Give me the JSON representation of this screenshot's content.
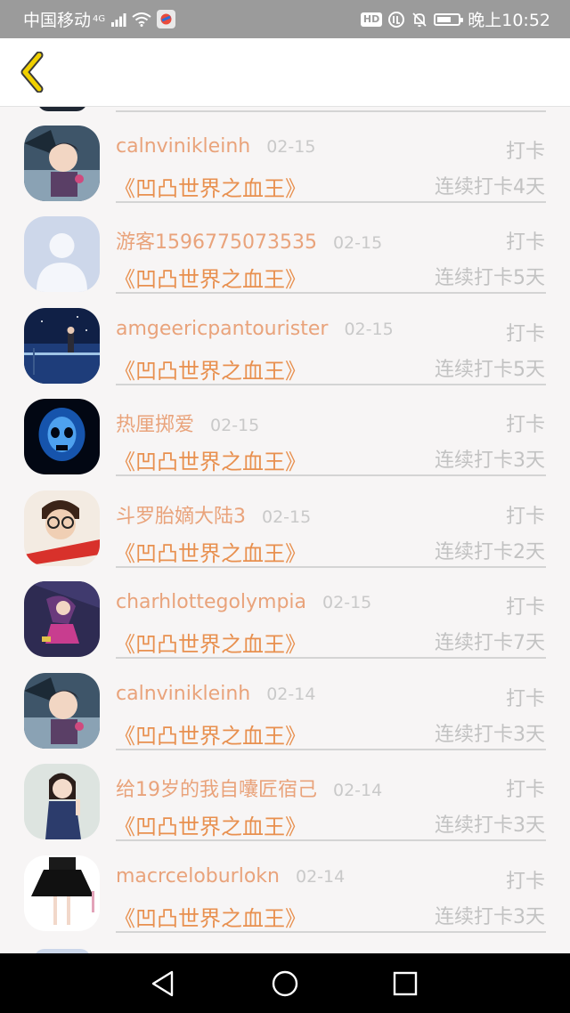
{
  "status_bar": {
    "carrier": "中国移动",
    "network": "4G",
    "time": "晚上10:52",
    "hd_badge": "HD",
    "battery_level": 0.68
  },
  "rows": [
    {
      "username": "calnvinikleinh",
      "date": "02-15",
      "action": "打卡",
      "book": "《凹凸世界之血王》",
      "streak": "连续打卡4天",
      "avatar": "anime-boy-avatar"
    },
    {
      "username": "游客1596775073535",
      "date": "02-15",
      "action": "打卡",
      "book": "《凹凸世界之血王》",
      "streak": "连续打卡5天",
      "avatar": "default-user-avatar"
    },
    {
      "username": "amgeericpantourister",
      "date": "02-15",
      "action": "打卡",
      "book": "《凹凸世界之血王》",
      "streak": "连续打卡5天",
      "avatar": "night-scene-avatar"
    },
    {
      "username": "热厘掷爱",
      "date": "02-15",
      "action": "打卡",
      "book": "《凹凸世界之血王》",
      "streak": "连续打卡3天",
      "avatar": "blue-skull-avatar"
    },
    {
      "username": "斗罗胎嫡大陆3",
      "date": "02-15",
      "action": "打卡",
      "book": "《凹凸世界之血王》",
      "streak": "连续打卡2天",
      "avatar": "glasses-boy-avatar"
    },
    {
      "username": "charhlottegolympia",
      "date": "02-15",
      "action": "打卡",
      "book": "《凹凸世界之血王》",
      "streak": "连续打卡7天",
      "avatar": "anime-girl-avatar"
    },
    {
      "username": "calnvinikleinh",
      "date": "02-14",
      "action": "打卡",
      "book": "《凹凸世界之血王》",
      "streak": "连续打卡3天",
      "avatar": "anime-boy-avatar"
    },
    {
      "username": "给19岁的我自囔匠宿己",
      "date": "02-14",
      "action": "打卡",
      "book": "《凹凸世界之血王》",
      "streak": "连续打卡3天",
      "avatar": "woman-photo-avatar"
    },
    {
      "username": "macrceloburlokn",
      "date": "02-14",
      "action": "打卡",
      "book": "《凹凸世界之血王》",
      "streak": "连续打卡3天",
      "avatar": "black-skirt-avatar"
    }
  ],
  "colors": {
    "username": "#e9a37b",
    "book_title": "#e8904f",
    "muted": "#c2c2c2",
    "back_arrow": "#f0d000"
  }
}
